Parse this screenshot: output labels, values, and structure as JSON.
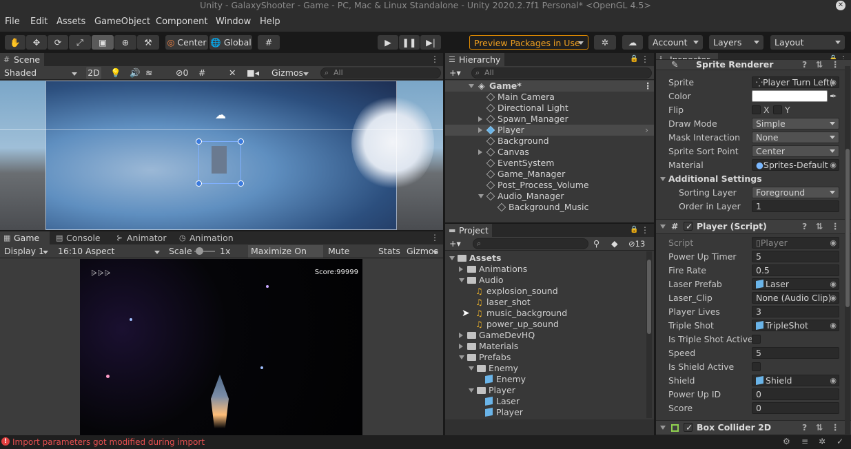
{
  "window": {
    "title": "Unity - GalaxyShooter - Game - PC, Mac & Linux Standalone - Unity 2020.2.7f1 Personal* <OpenGL 4.5>"
  },
  "menu": [
    "File",
    "Edit",
    "Assets",
    "GameObject",
    "Component",
    "Window",
    "Help"
  ],
  "toolbar": {
    "pivot": "Center",
    "space": "Global",
    "preview_packages": "Preview Packages in Use",
    "account": "Account",
    "layers": "Layers",
    "layout": "Layout"
  },
  "scene": {
    "tab": "Scene",
    "shading": "Shaded",
    "mode_2d": "2D",
    "hidden_count": "0",
    "gizmos": "Gizmos",
    "search_placeholder": "All"
  },
  "game": {
    "tabs": [
      "Game",
      "Console",
      "Animator",
      "Animation"
    ],
    "display": "Display 1",
    "aspect": "16:10 Aspect",
    "scale_label": "Scale",
    "scale_value": "1x",
    "maximize": "Maximize On Play",
    "mute": "Mute Audio",
    "stats": "Stats",
    "gizmos": "Gizmos",
    "score": "Score:99999"
  },
  "hierarchy": {
    "tab": "Hierarchy",
    "search_placeholder": "All",
    "scene_name": "Game*",
    "items": [
      "Main Camera",
      "Directional Light",
      "Spawn_Manager",
      "Player",
      "Background",
      "Canvas",
      "EventSystem",
      "Game_Manager",
      "Post_Process_Volume",
      "Audio_Manager",
      "Background_Music"
    ]
  },
  "project": {
    "tab": "Project",
    "hidden_count": "13",
    "items": [
      "Assets",
      "Animations",
      "Audio",
      "explosion_sound",
      "laser_shot",
      "music_background",
      "power_up_sound",
      "GameDevHQ",
      "Materials",
      "Prefabs",
      "Enemy",
      "Enemy",
      "Player",
      "Laser",
      "Player"
    ]
  },
  "inspector": {
    "tab": "Inspector",
    "sprite_renderer": {
      "header": "Sprite Renderer",
      "sprite_label": "Sprite",
      "sprite_value": "Player Turn Left(",
      "color_label": "Color",
      "flip_label": "Flip",
      "flip_x": "X",
      "flip_y": "Y",
      "draw_mode_label": "Draw Mode",
      "draw_mode_value": "Simple",
      "mask_label": "Mask Interaction",
      "mask_value": "None",
      "sort_point_label": "Sprite Sort Point",
      "sort_point_value": "Center",
      "material_label": "Material",
      "material_value": "Sprites-Default",
      "additional": "Additional Settings",
      "sorting_layer_label": "Sorting Layer",
      "sorting_layer_value": "Foreground",
      "order_label": "Order in Layer",
      "order_value": "1"
    },
    "player_script": {
      "header": "Player (Script)",
      "script_label": "Script",
      "script_value": "Player",
      "power_up_timer_label": "Power Up Timer",
      "power_up_timer_value": "5",
      "fire_rate_label": "Fire Rate",
      "fire_rate_value": "0.5",
      "laser_prefab_label": "Laser Prefab",
      "laser_prefab_value": "Laser",
      "laser_clip_label": "Laser_Clip",
      "laser_clip_value": "None (Audio Clip)",
      "player_lives_label": "Player Lives",
      "player_lives_value": "3",
      "triple_shot_label": "Triple Shot",
      "triple_shot_value": "TripleShot",
      "triple_active_label": "Is Triple Shot Active",
      "speed_label": "Speed",
      "speed_value": "5",
      "shield_active_label": "Is Shield Active",
      "shield_label": "Shield",
      "shield_value": "Shield",
      "power_up_id_label": "Power Up ID",
      "power_up_id_value": "0",
      "score_label": "Score",
      "score_value": "0"
    },
    "box_collider": {
      "header": "Box Collider 2D"
    }
  },
  "status": {
    "message": "Import parameters got modified during import"
  }
}
